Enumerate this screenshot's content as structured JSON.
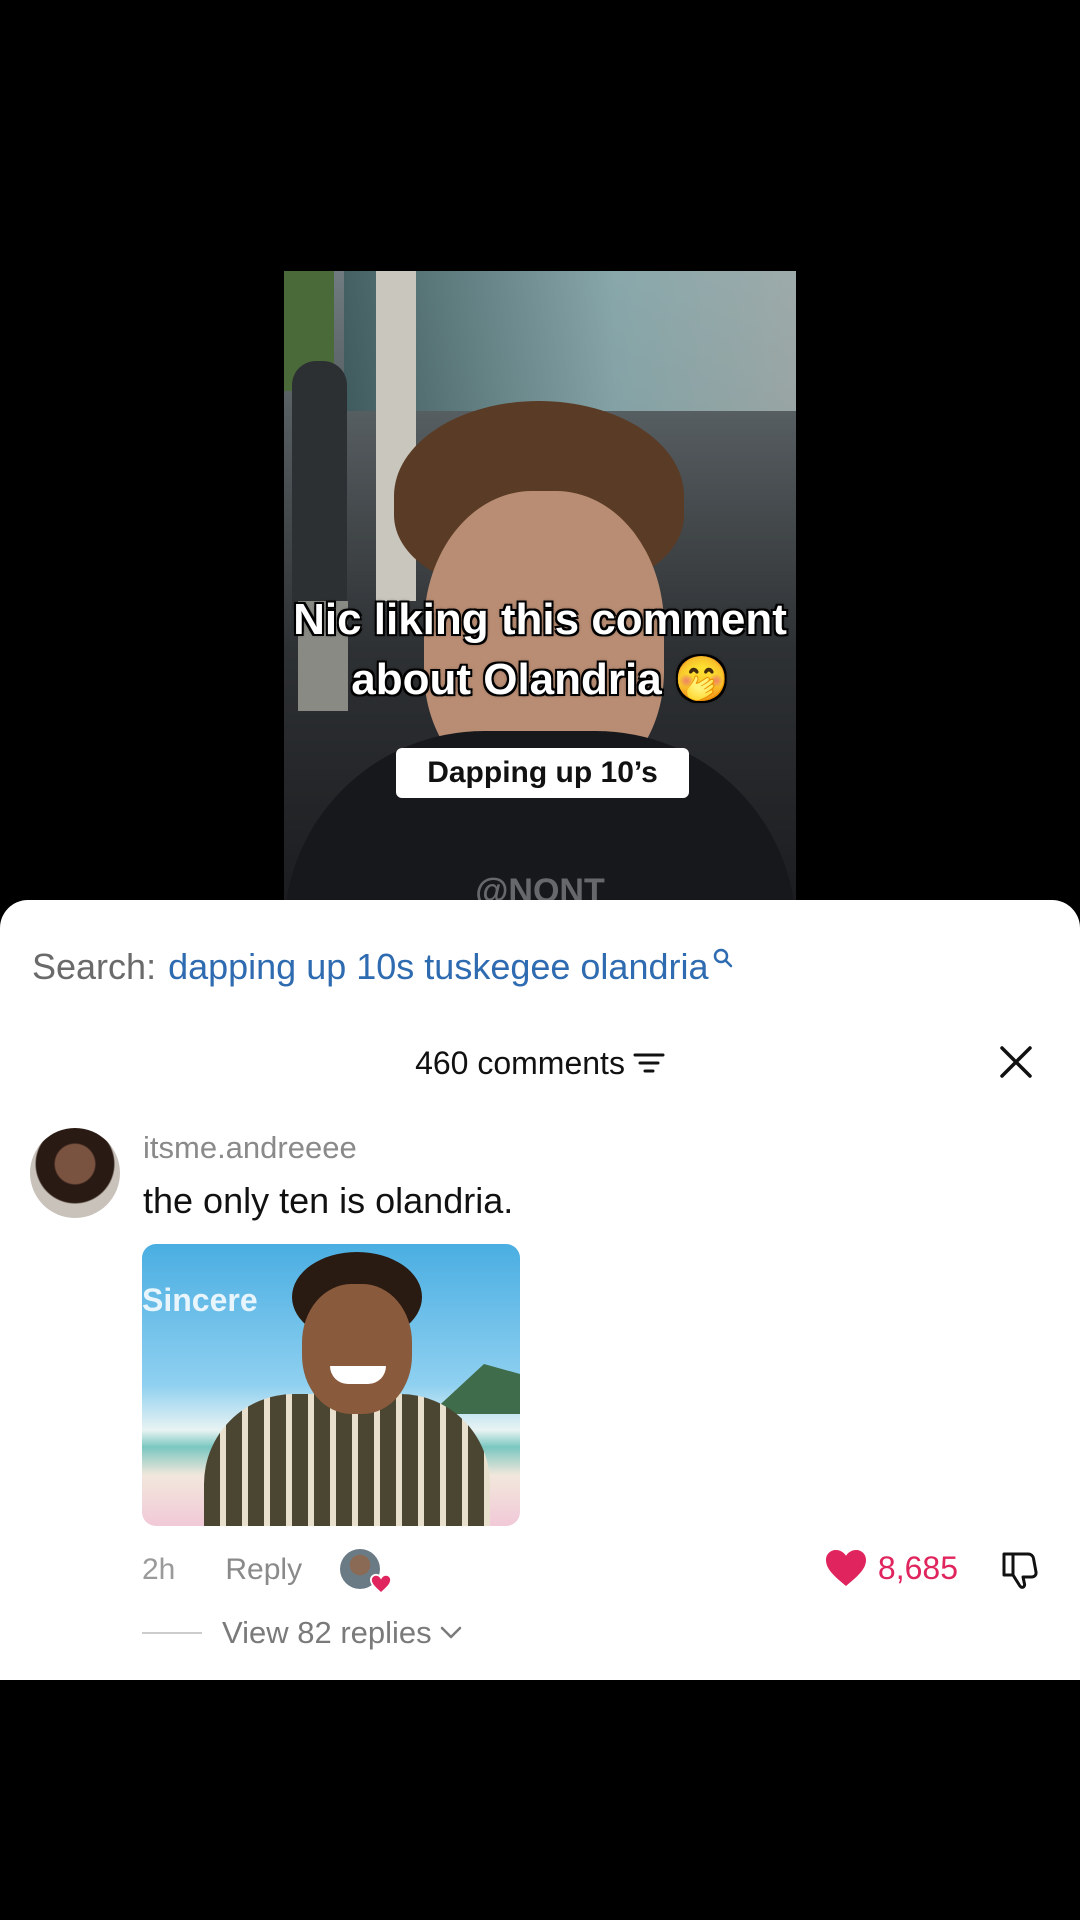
{
  "video": {
    "caption_line1": "Nic liking this comment",
    "caption_line2": "about Olandria 🤭",
    "tag": "Dapping up 10’s",
    "watermark": "@NONT"
  },
  "search": {
    "label": "Search:",
    "query": "dapping up 10s tuskegee olandria",
    "icon": "search-icon"
  },
  "comments_header": {
    "title": "460 comments",
    "sort_icon": "sort-icon",
    "close_icon": "close-icon"
  },
  "comment": {
    "username": "itsme.andreeee",
    "text": "the only ten is olandria.",
    "gif_caption": "Sincere",
    "time": "2h",
    "reply_label": "Reply",
    "like_count": "8,685",
    "replies_label": "View 82 replies"
  },
  "colors": {
    "accent_link": "#2e6bb0",
    "like": "#e0245e",
    "sheet_bg": "#ffffff",
    "page_bg": "#000000"
  }
}
